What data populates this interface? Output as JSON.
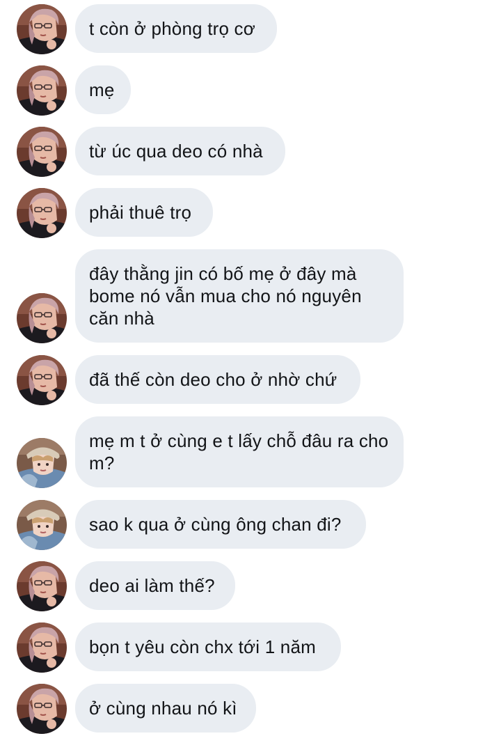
{
  "conversation": {
    "messages": [
      {
        "sender": "girl",
        "text": "t còn ở phòng trọ cơ"
      },
      {
        "sender": "girl",
        "text": "mẹ"
      },
      {
        "sender": "girl",
        "text": "từ úc qua deo có nhà"
      },
      {
        "sender": "girl",
        "text": "phải thuê trọ"
      },
      {
        "sender": "girl",
        "text": "đây thằng jin có bố mẹ ở đây mà bome nó vẫn mua cho nó nguyên căn nhà"
      },
      {
        "sender": "girl",
        "text": "đã thế còn deo cho ở nhờ chứ"
      },
      {
        "sender": "boy",
        "text": "mẹ m t ở cùng e t lấy chỗ đâu ra cho m?"
      },
      {
        "sender": "boy",
        "text": "sao k qua ở cùng ông chan đi?"
      },
      {
        "sender": "girl",
        "text": "deo ai làm thế?"
      },
      {
        "sender": "girl",
        "text": "bọn t yêu còn chx tới 1 năm"
      },
      {
        "sender": "girl",
        "text": "ở cùng nhau nó kì"
      }
    ]
  },
  "colors": {
    "bubble_background": "#e9edf2",
    "text": "#121417",
    "background": "#ffffff"
  },
  "icons": {
    "avatar_girl": "avatar-girl-icon",
    "avatar_boy": "avatar-boy-icon"
  }
}
